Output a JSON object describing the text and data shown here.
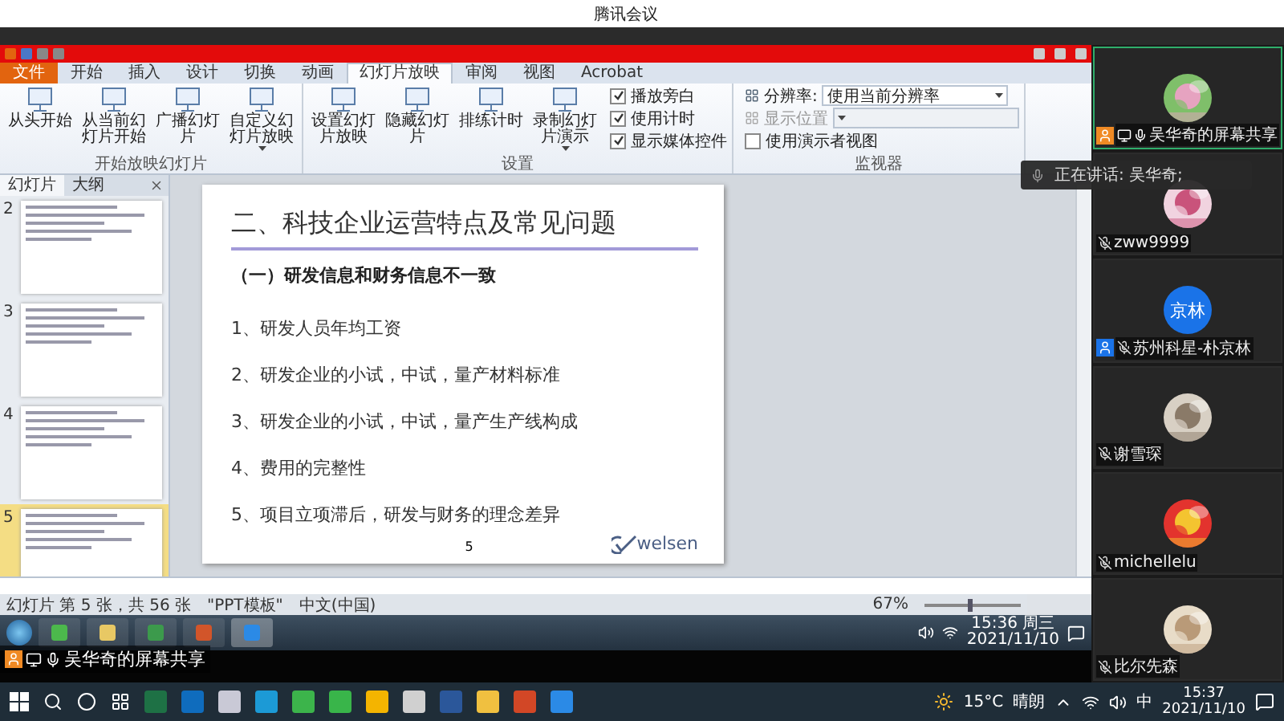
{
  "meeting": {
    "title": "腾讯会议"
  },
  "ppt": {
    "tabs": [
      {
        "label": "文件",
        "kind": "file",
        "selected": false
      },
      {
        "label": "开始",
        "kind": "tab",
        "selected": false
      },
      {
        "label": "插入",
        "kind": "tab",
        "selected": false
      },
      {
        "label": "设计",
        "kind": "tab",
        "selected": false
      },
      {
        "label": "切换",
        "kind": "tab",
        "selected": false
      },
      {
        "label": "动画",
        "kind": "tab",
        "selected": false
      },
      {
        "label": "幻灯片放映",
        "kind": "tab",
        "selected": true
      },
      {
        "label": "审阅",
        "kind": "tab",
        "selected": false
      },
      {
        "label": "视图",
        "kind": "tab",
        "selected": false
      },
      {
        "label": "Acrobat",
        "kind": "tab",
        "selected": false
      }
    ],
    "ribbon": [
      {
        "label": "开始放映幻灯片",
        "buttons": [
          {
            "label": "从头开始",
            "dropdown": false
          },
          {
            "label": "从当前幻灯片开始",
            "dropdown": false
          },
          {
            "label": "广播幻灯片",
            "dropdown": false
          },
          {
            "label": "自定义幻灯片放映",
            "dropdown": true
          }
        ]
      },
      {
        "label": "设置",
        "buttons": [
          {
            "label": "设置幻灯片放映",
            "dropdown": false
          },
          {
            "label": "隐藏幻灯片",
            "dropdown": false
          },
          {
            "label": "排练计时",
            "dropdown": false
          },
          {
            "label": "录制幻灯片演示",
            "dropdown": true
          }
        ],
        "options": [
          {
            "kind": "check",
            "label": "播放旁白",
            "checked": true
          },
          {
            "kind": "check",
            "label": "使用计时",
            "checked": true
          },
          {
            "kind": "check",
            "label": "显示媒体控件",
            "checked": true
          }
        ]
      },
      {
        "label": "监视器",
        "options": [
          {
            "kind": "select",
            "label": "分辨率:",
            "value": "使用当前分辨率",
            "disabled": false
          },
          {
            "kind": "select",
            "label": "显示位置",
            "disabled": true
          },
          {
            "kind": "check",
            "label": "使用演示者视图",
            "checked": false
          }
        ]
      }
    ],
    "side_tabs": [
      {
        "label": "幻灯片",
        "selected": true
      },
      {
        "label": "大纲",
        "selected": false
      }
    ],
    "thumbnails": [
      {
        "number": "2",
        "selected": false
      },
      {
        "number": "3",
        "selected": false
      },
      {
        "number": "4",
        "selected": false
      },
      {
        "number": "5",
        "selected": true
      }
    ],
    "slide": {
      "title": "二、科技企业运营特点及常见问题",
      "subtitle": "（一）研发信息和财务信息不一致",
      "items": [
        "1、研发人员年均工资",
        "2、研发企业的小试，中试，量产材料标准",
        "3、研发企业的小试，中试，量产生产线构成",
        "4、费用的完整性",
        "5、项目立项滞后，研发与财务的理念差异"
      ],
      "page": "5",
      "logo": "welsen"
    },
    "status": [
      "幻灯片 第 5 张，共 56 张",
      "\"PPT模板\"",
      "中文(中国)"
    ],
    "zoom": {
      "reading": "67%",
      "level": 0.45
    }
  },
  "old_taskbar": {
    "time": "15:36 周三",
    "date": "2021/11/10"
  },
  "share_label": "吴华奇的屏幕共享",
  "speaking_notice": "正在讲话: 吴华奇;",
  "participants": [
    {
      "name": "吴华奇的屏幕共享",
      "kind": "picture",
      "color": "#f08a24",
      "sharing": true,
      "muted": false,
      "speaking": true
    },
    {
      "name": "zww9999",
      "kind": "picture",
      "sharing": false,
      "muted": true,
      "speaking": false
    },
    {
      "name": "苏州科星-朴京林",
      "kind": "initials",
      "initials": "京林",
      "color": "#1a73e8",
      "sharing": false,
      "muted": true,
      "speaking": false
    },
    {
      "name": "谢雪琛",
      "kind": "picture",
      "sharing": false,
      "muted": true,
      "speaking": false
    },
    {
      "name": "michellelu",
      "kind": "picture",
      "sharing": false,
      "muted": true,
      "speaking": false
    },
    {
      "name": "比尔先森",
      "kind": "picture",
      "sharing": false,
      "muted": true,
      "speaking": false
    }
  ],
  "taskbar": {
    "temperature": "15°C",
    "weather": "晴朗",
    "ime": "中",
    "time": "15:37",
    "date": "2021/11/10"
  }
}
